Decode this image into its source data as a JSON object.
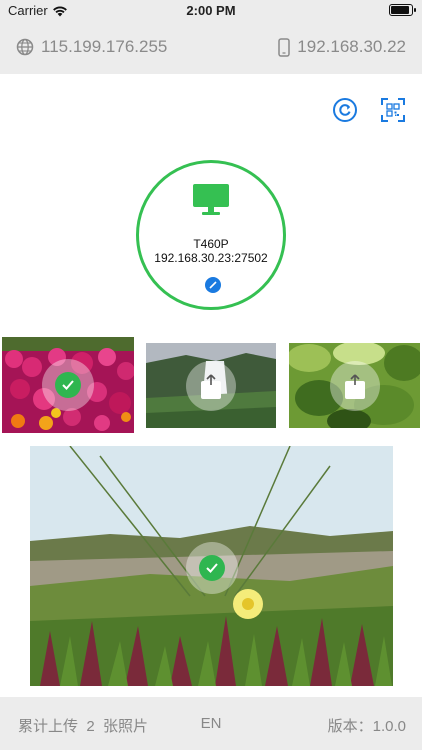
{
  "status": {
    "carrier": "Carrier",
    "time": "2:00 PM",
    "battery_level": 0.95
  },
  "ip_bar": {
    "public_ip": "115.199.176.255",
    "local_ip": "192.168.30.22"
  },
  "toolbar": {
    "refresh_icon": "refresh-icon",
    "scan_icon": "qr-scan-icon",
    "accent": "#1a7ae0"
  },
  "device": {
    "name": "T460P",
    "address": "192.168.30.23:27502",
    "ring_color": "#35c052",
    "icon": "monitor-icon"
  },
  "photos": [
    {
      "subject": "pink and orange flowers",
      "state": "uploaded"
    },
    {
      "subject": "waterfall in green valley",
      "state": "pending"
    },
    {
      "subject": "green leaves",
      "state": "pending"
    },
    {
      "subject": "grass on sand dunes with yellow flower",
      "state": "uploaded"
    }
  ],
  "footer": {
    "count_text": "累计上传  2  张照片",
    "language": "EN",
    "version_text": "版本：1.0.0"
  }
}
